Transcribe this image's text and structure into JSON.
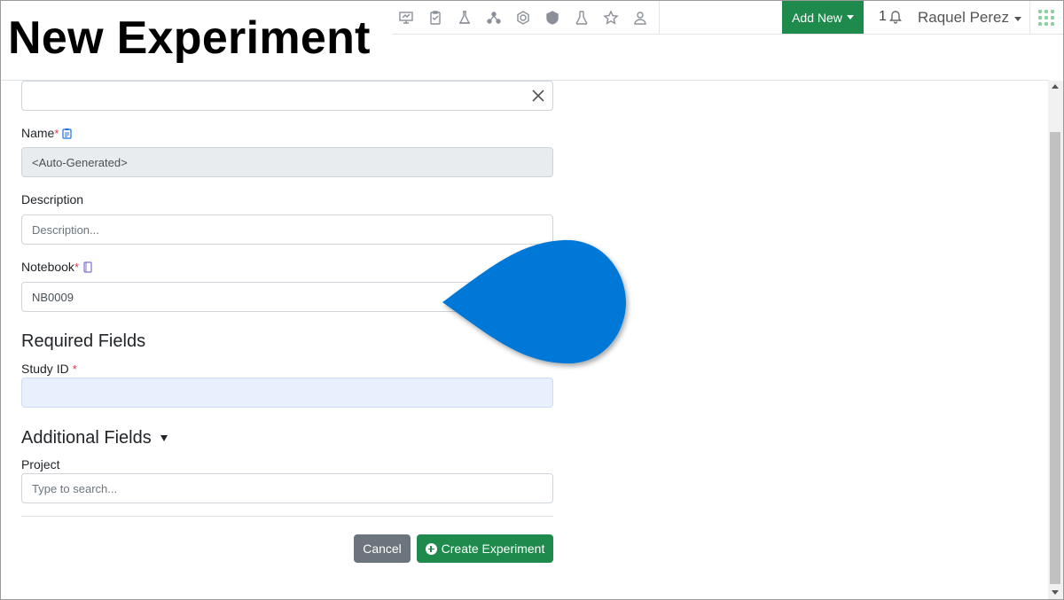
{
  "page_heading": "New Experiment",
  "navbar": {
    "icons": [
      "presentation-icon",
      "clipboard-icon",
      "lab-flask-icon",
      "molecule-icon",
      "hexagon-icon",
      "shield-icon",
      "beaker-icon",
      "star-icon",
      "users-icon"
    ],
    "add_new_label": "Add New",
    "notification_count": "1",
    "user_name": "Raquel Perez"
  },
  "form": {
    "top_field_value": "",
    "name": {
      "label": "Name",
      "required_mark": "*",
      "value": "<Auto-Generated>"
    },
    "description": {
      "label": "Description",
      "placeholder": "Description..."
    },
    "notebook": {
      "label": "Notebook",
      "required_mark": "*",
      "value": "NB0009"
    },
    "required_fields": {
      "title": "Required Fields",
      "study_id": {
        "label": "Study ID",
        "required_mark": "*",
        "value": ""
      }
    },
    "additional_fields": {
      "title": "Additional Fields",
      "project": {
        "label": "Project",
        "placeholder": "Type to search..."
      }
    },
    "buttons": {
      "cancel": "Cancel",
      "create": "Create Experiment"
    }
  },
  "colors": {
    "brand_green": "#1e8a4c",
    "cancel_gray": "#6c757d",
    "required_red": "#dc3545",
    "callout_blue": "#0078d7",
    "highlight_field": "#e8f0fe"
  }
}
